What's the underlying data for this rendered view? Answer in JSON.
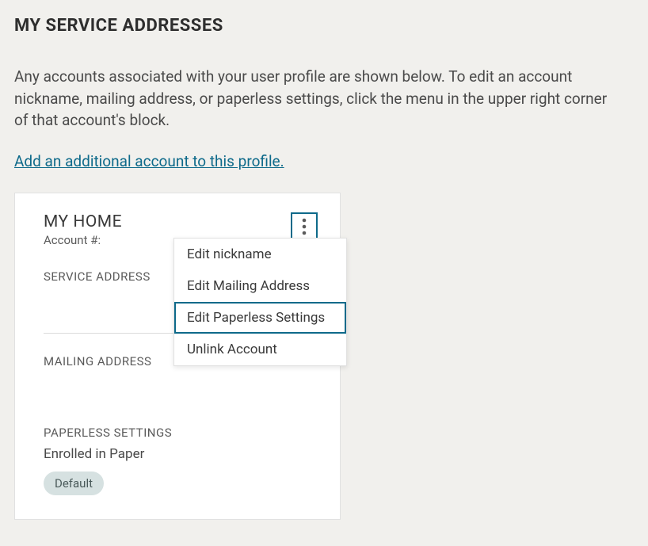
{
  "header": {
    "title": "MY SERVICE ADDRESSES",
    "description": "Any accounts associated with your user profile are shown below. To edit an account nickname, mailing address, or paperless settings, click the menu in the upper right corner of that account's block.",
    "add_link": "Add an additional account to this profile."
  },
  "account": {
    "title": "MY HOME",
    "account_label": "Account #:",
    "section_service": "SERVICE ADDRESS",
    "section_mailing": "MAILING ADDRESS",
    "section_paperless": "PAPERLESS SETTINGS",
    "paperless_status": "Enrolled in Paper",
    "default_badge": "Default"
  },
  "menu": {
    "items": [
      {
        "label": "Edit nickname",
        "highlighted": false
      },
      {
        "label": "Edit Mailing Address",
        "highlighted": false
      },
      {
        "label": "Edit Paperless Settings",
        "highlighted": true
      },
      {
        "label": "Unlink Account",
        "highlighted": false
      }
    ]
  }
}
